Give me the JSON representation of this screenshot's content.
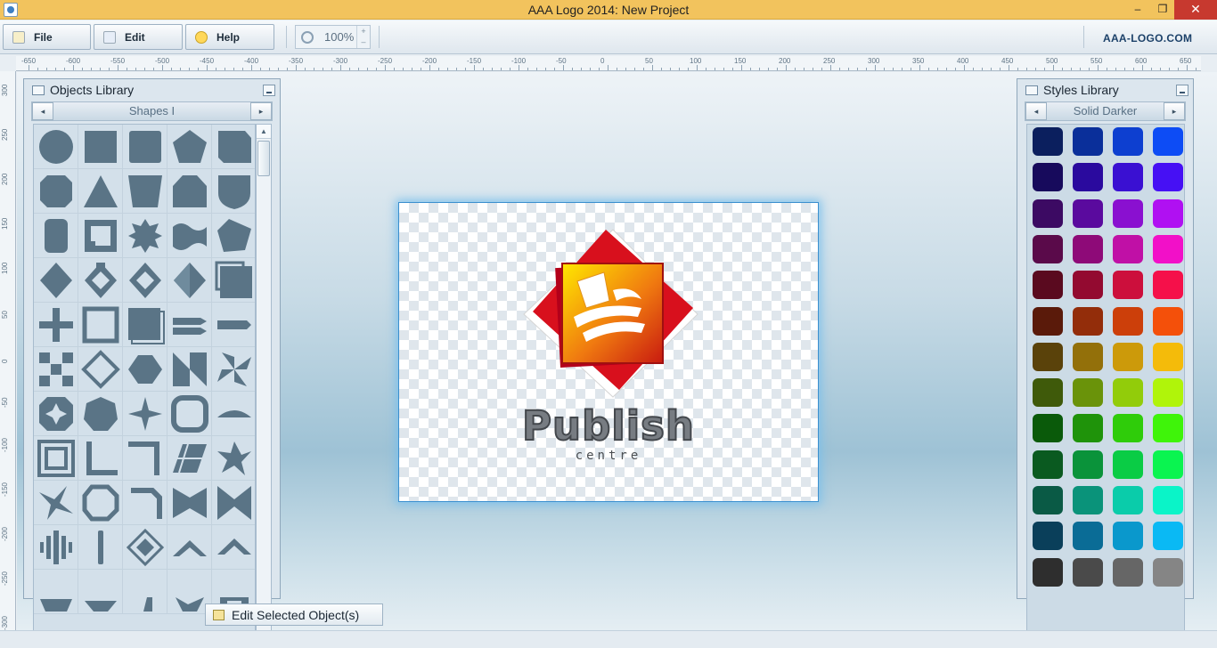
{
  "window": {
    "title": "AAA Logo 2014: New Project",
    "minimize": "–",
    "maximize": "❐",
    "close": "✕"
  },
  "toolbar": {
    "file_label": "File",
    "edit_label": "Edit",
    "help_label": "Help",
    "zoom_value": "100%",
    "zoom_up": "+",
    "zoom_down": "–",
    "brand": "AAA-LOGO.COM"
  },
  "rulers": {
    "top": [
      "-650",
      "-600",
      "-550",
      "-500",
      "-450",
      "-400",
      "-350",
      "-300",
      "-250",
      "-200",
      "-150",
      "-100",
      "-50",
      "0",
      "50",
      "100",
      "150",
      "200",
      "250",
      "300",
      "350",
      "400",
      "450",
      "500",
      "550",
      "600",
      "650"
    ],
    "left": [
      "300",
      "250",
      "200",
      "150",
      "100",
      "50",
      "0",
      "-50",
      "-100",
      "-150",
      "-200",
      "-250",
      "-300"
    ]
  },
  "objects_library": {
    "title": "Objects Library",
    "category": "Shapes I",
    "prev": "◂",
    "next": "▸",
    "shapes": [
      "circle",
      "square",
      "rounded-square",
      "pentagon",
      "cut-corner-square",
      "octagon",
      "triangle",
      "trapezoid",
      "house-pentagon",
      "shield",
      "cylinder",
      "square-frame",
      "star-burst",
      "wave",
      "tilted-pentagon",
      "diamond",
      "diamond-notched",
      "diamond-outline",
      "diamond-half",
      "square-layered",
      "plus",
      "square-outline",
      "square-offset",
      "arrow-double",
      "arrow-right",
      "checker-cross",
      "diamond-frame",
      "octagon-wide",
      "windmill-square",
      "pinwheel",
      "star-octagon",
      "heptagon",
      "star-four",
      "rounded-frame",
      "arch-flat",
      "square-bevel",
      "corner-l",
      "corner-reverse",
      "parallelogram-grid",
      "star-spin",
      "star-quad",
      "cube-ribbon",
      "hook",
      "bowtie",
      "bowtie-wide",
      "bars-diamond",
      "bar-vertical",
      "diamond-stack",
      "chevron-up",
      "chevron-up-wide",
      "partial-a",
      "partial-b",
      "partial-c",
      "partial-d",
      "partial-e"
    ]
  },
  "styles_library": {
    "title": "Styles Library",
    "category": "Solid Darker",
    "prev": "◂",
    "next": "▸",
    "swatches": [
      [
        "#0b1f5e",
        "#0a2f9a",
        "#0d3fd0",
        "#0d4cf5"
      ],
      [
        "#170a5c",
        "#2a0a9e",
        "#3a10d2",
        "#4610f4"
      ],
      [
        "#3c0a63",
        "#5a0a9e",
        "#8a10d0",
        "#b010f2"
      ],
      [
        "#5a0a4a",
        "#8e0a78",
        "#c010a6",
        "#f210c8"
      ],
      [
        "#5a0a1f",
        "#930a30",
        "#cc0f3c",
        "#f5104a"
      ],
      [
        "#5a1a0a",
        "#932d0a",
        "#cc3f0a",
        "#f4500a"
      ],
      [
        "#5a420a",
        "#93700a",
        "#cc9a0a",
        "#f4bb0a"
      ],
      [
        "#3f5a0a",
        "#6a930a",
        "#92cc0a",
        "#b0f40a"
      ],
      [
        "#0a5a0a",
        "#1f930a",
        "#2fcc0a",
        "#3ff40a"
      ],
      [
        "#0a5a20",
        "#0a933a",
        "#0acc45",
        "#0af450"
      ],
      [
        "#0a5a45",
        "#0a937a",
        "#0accaa",
        "#0af4c8"
      ],
      [
        "#0a3f5a",
        "#0a6c96",
        "#0a98cc",
        "#0ab9f4"
      ],
      [
        "#2e2e2e",
        "#4a4a4a",
        "#666666",
        "#858585"
      ]
    ]
  },
  "canvas": {
    "logo_text": "Publish",
    "logo_subtext": "centre"
  },
  "edit_selected_label": "Edit Selected Object(s)"
}
